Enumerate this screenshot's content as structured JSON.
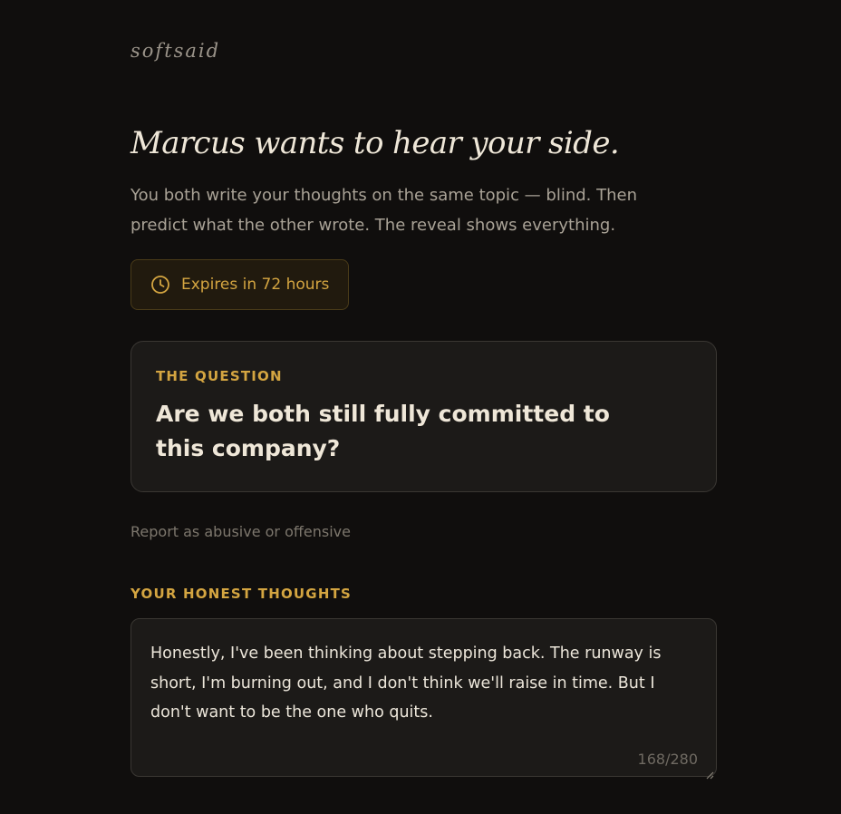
{
  "brand": {
    "name": "softsaid"
  },
  "intro": {
    "headline": "Marcus wants to hear your side.",
    "subtitle": "You both write your thoughts on the same topic — blind. Then predict what the other wrote. The reveal shows everything."
  },
  "expiry": {
    "icon": "clock-icon",
    "text": "Expires in 72 hours"
  },
  "question": {
    "label": "THE QUESTION",
    "text": "Are we both still fully committed to this company?"
  },
  "report": {
    "label": "Report as abusive or offensive"
  },
  "thoughts": {
    "label": "YOUR HONEST THOUGHTS",
    "value": "Honestly, I've been thinking about stepping back. The runway is short, I'm burning out, and I don't think we'll raise in time. But I don't want to be the one who quits.",
    "counter": "168/280"
  },
  "colors": {
    "background": "#100e0d",
    "accent": "#d4a541",
    "card": "#1c1a18",
    "muted_text": "#a9a296"
  }
}
